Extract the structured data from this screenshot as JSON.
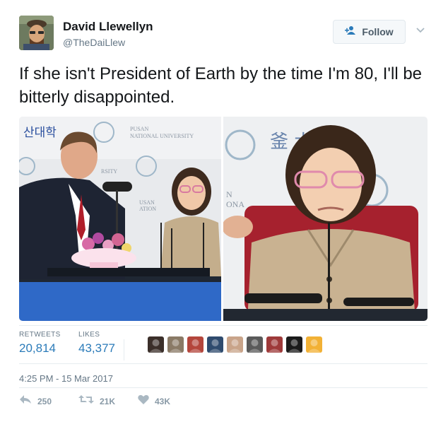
{
  "author": {
    "name": "David Llewellyn",
    "handle": "@TheDaiLlew"
  },
  "follow_button": {
    "label": "Follow"
  },
  "tweet": {
    "text": "If she isn't President of Earth by the time I'm 80, I'll be bitterly disappointed."
  },
  "media": {
    "signs": {
      "korean_left": "산대학",
      "pusan_left": "PUSAN\nNATIONAL UNIVERSITY",
      "sub_sity": "RSITY",
      "pusan_small": "USAN\nATION",
      "hanja_right": "釜 大學校",
      "n_right": "N\nONA"
    }
  },
  "stats": {
    "retweets_label": "RETWEETS",
    "retweets": "20,814",
    "likes_label": "LIKES",
    "likes": "43,377"
  },
  "likers": [
    {
      "color": "#3b2f2a"
    },
    {
      "color": "#8a7a66"
    },
    {
      "color": "#b4463c"
    },
    {
      "color": "#2f4b6e"
    },
    {
      "color": "#c9a48a"
    },
    {
      "color": "#5a5a5a"
    },
    {
      "color": "#9e3a3a"
    },
    {
      "color": "#1b1b1b"
    },
    {
      "color": "#f2b135"
    }
  ],
  "timestamp": "4:25 PM - 15 Mar 2017",
  "actions": {
    "reply_count": "250",
    "retweet_count": "21K",
    "like_count": "43K"
  },
  "colors": {
    "link": "#2b7bb9",
    "muted": "#657786",
    "icon": "#aab8c2"
  }
}
